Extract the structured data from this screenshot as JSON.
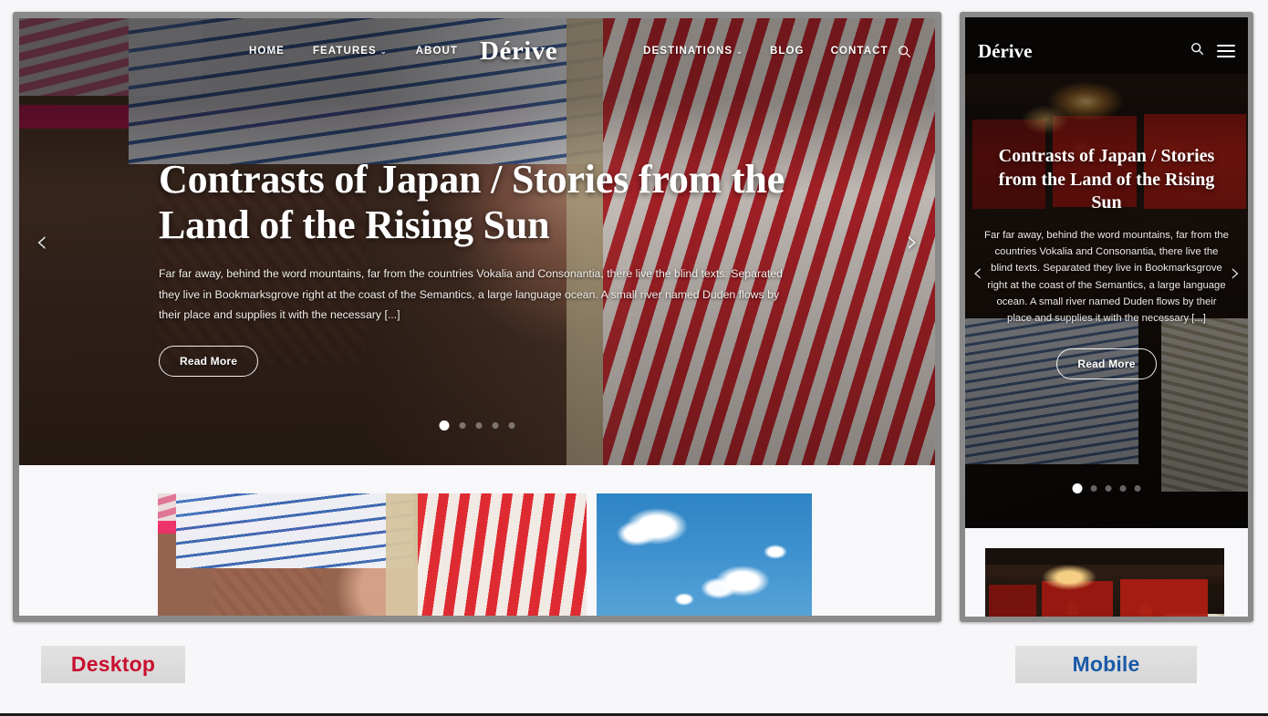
{
  "page": {
    "background": "#f7f6f8",
    "frame_color": "#8a8a8a"
  },
  "desktop": {
    "nav": {
      "brand": "Dérive",
      "left_links": [
        {
          "label": "HOME",
          "has_caret": false
        },
        {
          "label": "FEATURES",
          "has_caret": true
        },
        {
          "label": "ABOUT",
          "has_caret": false
        }
      ],
      "right_links": [
        {
          "label": "DESTINATIONS",
          "has_caret": true
        },
        {
          "label": "BLOG",
          "has_caret": false
        },
        {
          "label": "CONTACT",
          "has_caret": false
        }
      ],
      "search_icon": "search-icon",
      "caret": "⌄"
    },
    "hero": {
      "title": "Contrasts of Japan / Stories from the Land of the Rising Sun",
      "text": "Far far away, behind the word mountains, far from the countries Vokalia and Consonantia, there live the blind texts. Separated they live in Bookmarksgrove right at the coast of the Semantics, a large language ocean. A small river named Duden flows by their place and supplies it with the necessary [...]",
      "button": "Read More",
      "prev_arrow": "‹",
      "next_arrow": "›",
      "dots_total": 5,
      "dots_active_index": 0
    },
    "cards": [
      {
        "name": "umbrella-photo-card"
      },
      {
        "name": "sky-photo-card"
      }
    ]
  },
  "mobile": {
    "nav": {
      "brand": "Dérive",
      "search_icon": "search-icon",
      "menu_icon": "hamburger-menu-icon"
    },
    "hero": {
      "title": "Contrasts of Japan / Stories from the Land of the Rising Sun",
      "text": "Far far away, behind the word mountains, far from the countries Vokalia and Consonantia, there live the blind texts. Separated they live in Bookmarksgrove right at the coast of the Semantics, a large language ocean. A small river named Duden flows by their place and supplies it with the necessary [...]",
      "button": "Read More",
      "prev_arrow": "‹",
      "next_arrow": "›",
      "dots_total": 5,
      "dots_active_index": 0
    },
    "cards": [
      {
        "name": "interior-photo-card"
      }
    ]
  },
  "toggles": {
    "desktop_label": "Desktop",
    "desktop_color": "#c8102e",
    "mobile_label": "Mobile",
    "mobile_color": "#1a5aa8"
  }
}
